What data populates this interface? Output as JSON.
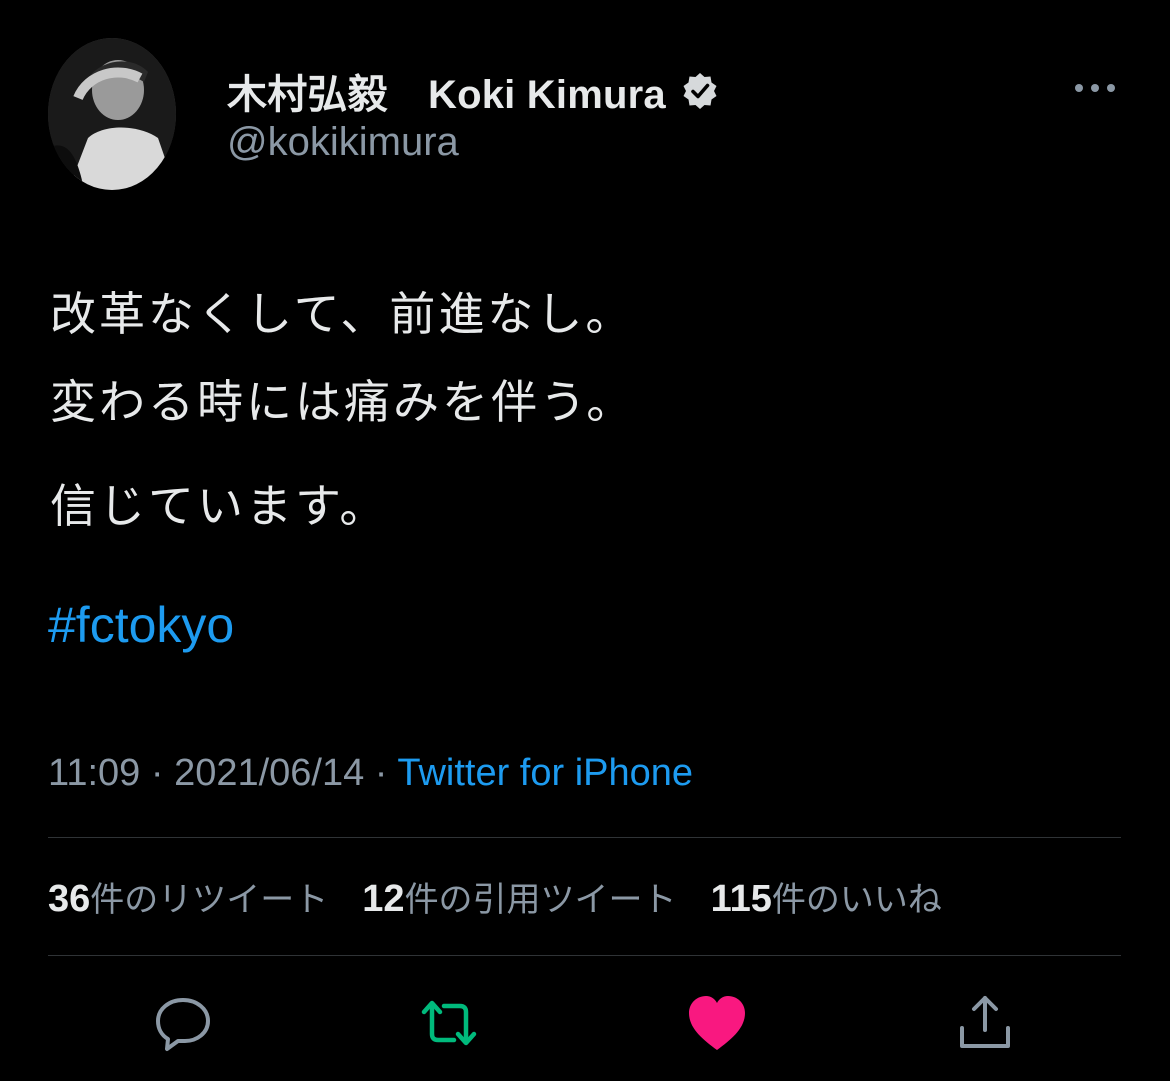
{
  "author": {
    "display_name": "木村弘毅　Koki Kimura",
    "handle": "@kokikimura",
    "verified_icon": "verified-badge-icon"
  },
  "tweet": {
    "lines_para1": [
      "改革なくして、前進なし。",
      "変わる時には痛みを伴う。"
    ],
    "line_para2": "信じています。",
    "hashtag": "#fctokyo",
    "time": "11:09",
    "separator": " · ",
    "date": "2021/06/14",
    "source": "Twitter for iPhone"
  },
  "stats": {
    "retweets_count": "36",
    "retweets_label": "件のリツイート",
    "quotes_count": "12",
    "quotes_label": "件の引用ツイート",
    "likes_count": "115",
    "likes_label": "件のいいね"
  },
  "actions": {
    "reply_icon": "reply-icon",
    "retweet_icon": "retweet-icon",
    "like_icon": "heart-icon",
    "share_icon": "share-icon"
  },
  "colors": {
    "background": "#000000",
    "text": "#e7e9ea",
    "secondary": "#8b98a5",
    "link": "#1d9bf0",
    "retweet_active": "#00ba7c",
    "like_active": "#f91880",
    "divider": "#2f3336"
  }
}
